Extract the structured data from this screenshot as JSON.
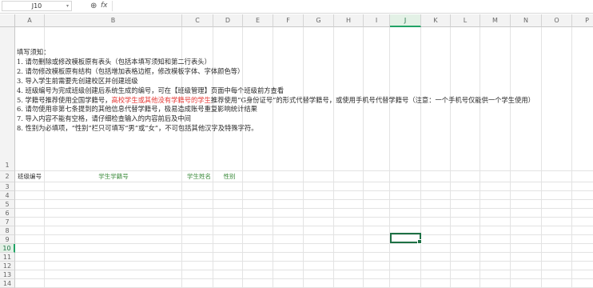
{
  "formula_bar": {
    "name_box": "J10",
    "zoom_icon": "magnifier-icon",
    "fx_label": "fx",
    "formula_value": ""
  },
  "columns": [
    "A",
    "B",
    "C",
    "D",
    "E",
    "F",
    "G",
    "H",
    "I",
    "J",
    "K",
    "L",
    "M",
    "N",
    "O",
    "P"
  ],
  "active_column": "J",
  "active_row": "10",
  "notes": {
    "title": "填写须知：",
    "lines": [
      "1. 请勿删除或修改模板原有表头（包括本填写须知和第二行表头）",
      "2. 请勿修改模板原有结构（包括增加表格边框，修改模板字体、字体颜色等）",
      "3. 导入学生前需要先创建校区并创建班级",
      "4. 班级编号为完成班级创建后系统生成的编号，可在【班级管理】页面中每个班级前方查看",
      "6. 请勿使用非第七条提到的其他信息代替学籍号，极易造成账号重复影响统计结果",
      "7. 导入内容不能有空格，请仔细检查输入的内容前后及中间",
      "8. 性别为必填项，“性别”栏只可填写“男”或“女”，不可包括其他汉字及特殊字符。"
    ],
    "line5": {
      "prefix": "5. 学籍号推荐使用全国学籍号，",
      "highlight": "高校学生或其他没有学籍号的学生",
      "suffix": "推荐使用“G身份证号”的形式代替学籍号，或使用手机号代替学籍号（注意：一个手机号仅能供一个学生使用）"
    },
    "highlight_color": "#e53935"
  },
  "header_row": {
    "row_number": "2",
    "class_id": "班级编号",
    "student_id": "学生学籍号",
    "student_name": "学生姓名",
    "gender": "性别"
  },
  "row_numbers": [
    "1",
    "2",
    "3",
    "4",
    "5",
    "6",
    "7",
    "8",
    "9",
    "10",
    "11",
    "12",
    "13",
    "14"
  ]
}
